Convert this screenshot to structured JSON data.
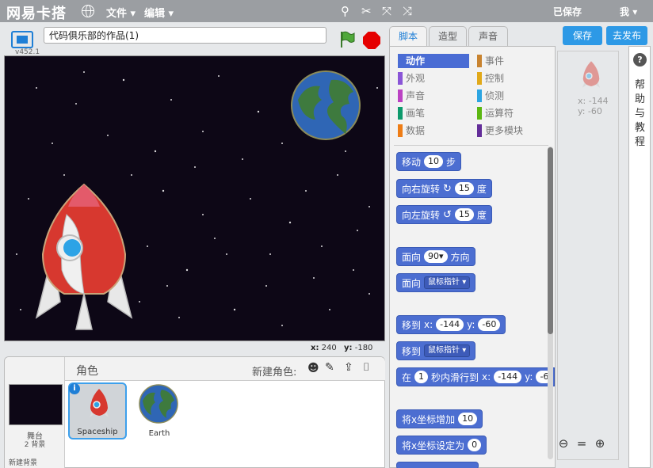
{
  "topbar": {
    "logo": "网易卡搭",
    "menu_file": "文件",
    "menu_edit": "编辑",
    "saved": "已保存",
    "user": "我"
  },
  "stage": {
    "version": "v452.1",
    "project_title": "代码俱乐部的作品(1)",
    "x_label": "x:",
    "x_value": "240",
    "y_label": "y:",
    "y_value": "-180"
  },
  "sprites": {
    "label": "角色",
    "new_sprite": "新建角色:",
    "stage_name": "舞台",
    "stage_backdrops": "2 背景",
    "new_backdrop": "新建背景",
    "items": [
      {
        "name": "Spaceship",
        "selected": true
      },
      {
        "name": "Earth",
        "selected": false
      }
    ]
  },
  "tabs": [
    "脚本",
    "造型",
    "声音"
  ],
  "buttons": {
    "save": "保存",
    "publish": "去发布"
  },
  "categories": [
    {
      "label": "动作",
      "color": "#4a6cd4"
    },
    {
      "label": "事件",
      "color": "#c88330"
    },
    {
      "label": "外观",
      "color": "#8a55d7"
    },
    {
      "label": "控制",
      "color": "#e1a91a"
    },
    {
      "label": "声音",
      "color": "#bb42c3"
    },
    {
      "label": "侦测",
      "color": "#2ca5e2"
    },
    {
      "label": "画笔",
      "color": "#0e9a6c"
    },
    {
      "label": "运算符",
      "color": "#5cb712"
    },
    {
      "label": "数据",
      "color": "#ee7d16"
    },
    {
      "label": "更多模块",
      "color": "#632d99"
    }
  ],
  "blocks": {
    "move": {
      "text": "移动",
      "value": "10",
      "suffix": "步"
    },
    "turn_right": {
      "text": "向右旋转",
      "value": "15",
      "suffix": "度"
    },
    "turn_left": {
      "text": "向左旋转",
      "value": "15",
      "suffix": "度"
    },
    "point_dir": {
      "text": "面向",
      "value": "90",
      "suffix": "方向"
    },
    "point_towards": {
      "text": "面向",
      "option": "鼠标指针"
    },
    "goto_xy": {
      "text": "移到",
      "x_label": "x:",
      "x": "-144",
      "y_label": "y:",
      "y": "-60"
    },
    "goto": {
      "text": "移到",
      "option": "鼠标指针"
    },
    "glide": {
      "text": "在",
      "secs": "1",
      "middle": "秒内滑行到",
      "x_label": "x:",
      "x": "-144",
      "y_label": "y:",
      "y": "-6"
    },
    "change_x": {
      "text": "将x坐标增加",
      "value": "10"
    },
    "set_x": {
      "text": "将x坐标设定为",
      "value": "0"
    }
  },
  "scripts_area": {
    "x_label": "x: -144",
    "y_label": "y: -60"
  },
  "help": {
    "q": "?",
    "text": "帮助与教程"
  }
}
